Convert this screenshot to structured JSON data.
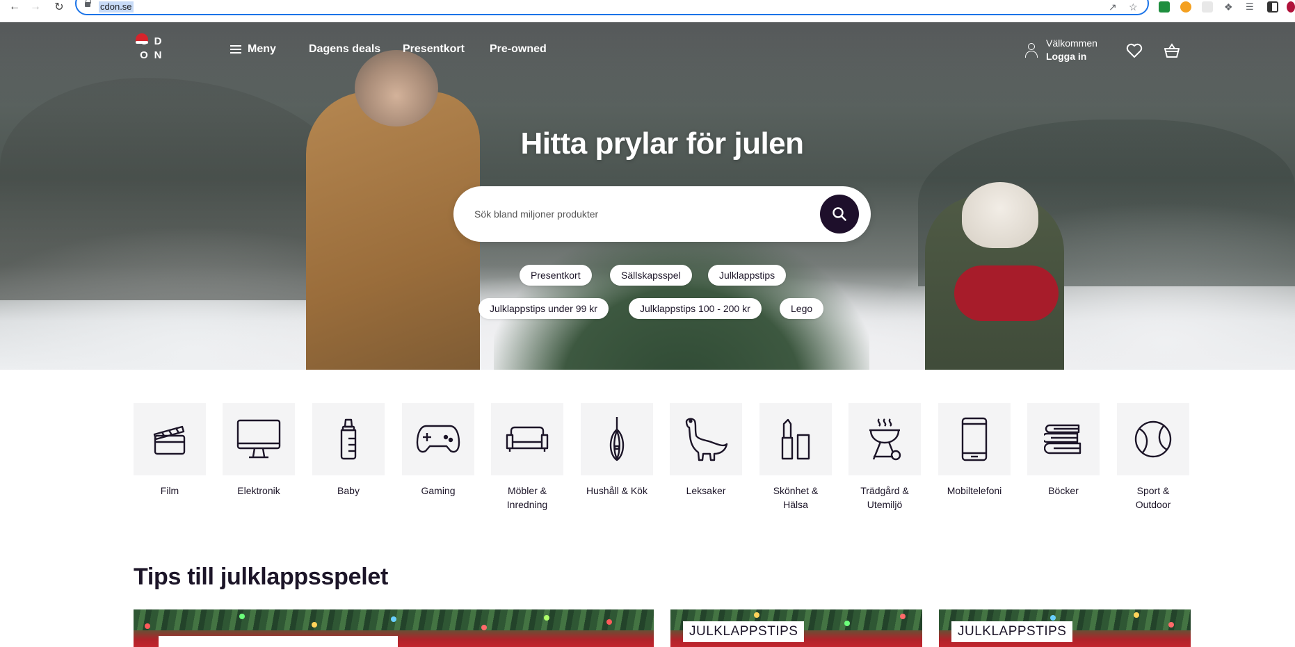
{
  "browser": {
    "url": "cdon.se"
  },
  "header": {
    "logo_letters": [
      "C",
      "D",
      "O",
      "N"
    ],
    "menu_label": "Meny",
    "nav": [
      "Dagens deals",
      "Presentkort",
      "Pre-owned"
    ],
    "welcome_line1": "Välkommen",
    "welcome_line2": "Logga in"
  },
  "hero": {
    "title": "Hitta prylar för julen",
    "search_placeholder": "Sök bland miljoner produkter",
    "chips_row1": [
      "Presentkort",
      "Sällskapsspel",
      "Julklappstips"
    ],
    "chips_row2": [
      "Julklappstips under 99 kr",
      "Julklappstips 100 - 200 kr",
      "Lego"
    ]
  },
  "categories": [
    {
      "label": "Film",
      "icon": "clapperboard-icon"
    },
    {
      "label": "Elektronik",
      "icon": "monitor-icon"
    },
    {
      "label": "Baby",
      "icon": "baby-bottle-icon"
    },
    {
      "label": "Gaming",
      "icon": "gamepad-icon"
    },
    {
      "label": "Möbler & Inredning",
      "icon": "sofa-icon"
    },
    {
      "label": "Hushåll & Kök",
      "icon": "whisk-icon"
    },
    {
      "label": "Leksaker",
      "icon": "dinosaur-icon"
    },
    {
      "label": "Skönhet & Hälsa",
      "icon": "lipstick-icon"
    },
    {
      "label": "Trädgård & Utemiljö",
      "icon": "grill-icon"
    },
    {
      "label": "Mobiltelefoni",
      "icon": "smartphone-icon"
    },
    {
      "label": "Böcker",
      "icon": "books-icon"
    },
    {
      "label": "Sport & Outdoor",
      "icon": "tennis-ball-icon"
    }
  ],
  "tips": {
    "title": "Tips till julklappsspelet",
    "cards": [
      {
        "tag": ""
      },
      {
        "tag": "JULKLAPPSTIPS"
      },
      {
        "tag": "JULKLAPPSTIPS"
      }
    ]
  },
  "colors": {
    "accent": "#1e0f2b",
    "tile_bg": "#f4f4f5",
    "text": "#1c1528"
  }
}
